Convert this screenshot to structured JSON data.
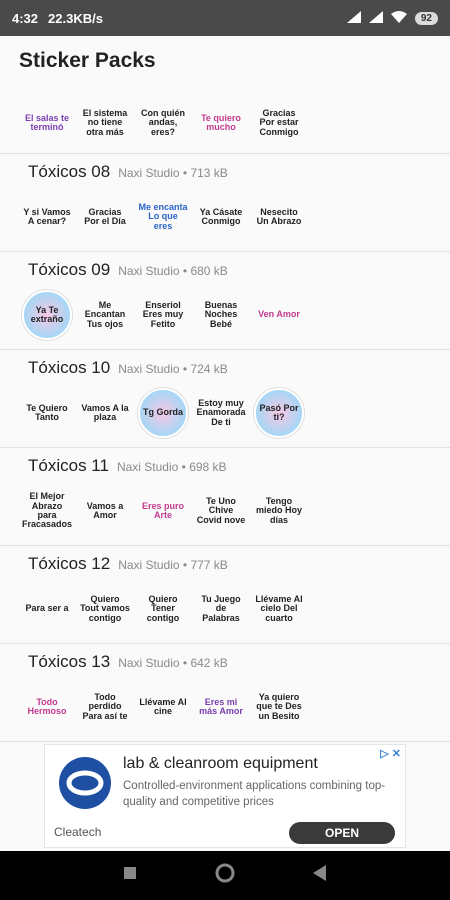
{
  "status": {
    "time": "4:32",
    "speed": "22.3KB/s",
    "battery": "92"
  },
  "appbar": {
    "title": "Sticker Packs"
  },
  "packs": [
    {
      "name": "",
      "meta": "",
      "stickers": [
        "El salas te terminó",
        "El sistema no tiene otra más",
        "Con quién andas, eres?",
        "Te quiero mucho",
        "Gracias Por estar Conmigo"
      ]
    },
    {
      "name": "Tóxicos 08",
      "meta": "Naxi Studio • 713 kB",
      "stickers": [
        "Y si Vamos A cenar?",
        "Gracias Por el Día",
        "Me encanta Lo que eres",
        "Ya Cásate Conmigo",
        "Nesecito Un Abrazo"
      ]
    },
    {
      "name": "Tóxicos 09",
      "meta": "Naxi Studio • 680 kB",
      "stickers": [
        "Ya Te extraño",
        "Me Encantan Tus ojos",
        "Enseriol Eres muy Fetito",
        "Buenas Noches Bebé",
        "Ven Amor"
      ]
    },
    {
      "name": "Tóxicos 10",
      "meta": "Naxi Studio • 724 kB",
      "stickers": [
        "Te Quiero Tanto",
        "Vamos A la plaza",
        "Tg Gorda",
        "Estoy muy Enamorada De ti",
        "Pasó Por ti?"
      ]
    },
    {
      "name": "Tóxicos 11",
      "meta": "Naxi Studio • 698 kB",
      "stickers": [
        "El Mejor Abrazo para Fracasados",
        "Vamos a Amor",
        "Eres puro Arte",
        "Te Uno Chive Covid nove",
        "Tengo miedo Hoy días"
      ]
    },
    {
      "name": "Tóxicos 12",
      "meta": "Naxi Studio • 777 kB",
      "stickers": [
        "Para ser a",
        "Quiero Tout vamos contigo",
        "Quiero Tener contigo",
        "Tu Juego de Palabras",
        "Llévame Al cielo Del cuarto"
      ]
    },
    {
      "name": "Tóxicos 13",
      "meta": "Naxi Studio • 642 kB",
      "stickers": [
        "Todo Hermoso",
        "Todo perdido Para así te",
        "Llévame Al cine",
        "Eres mi más Amor",
        "Ya quiero que te Des un Besito"
      ]
    }
  ],
  "ad": {
    "title": "lab & cleanroom equipment",
    "description": "Controlled-environment applications combining top-quality and competitive prices",
    "brand": "Cleatech",
    "cta": "OPEN"
  }
}
